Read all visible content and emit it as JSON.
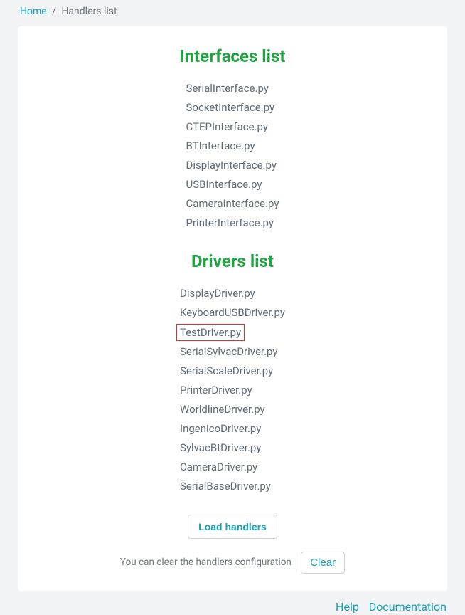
{
  "breadcrumb": {
    "home": "Home",
    "current": "Handlers list"
  },
  "sections": {
    "interfaces_title": "Interfaces list",
    "drivers_title": "Drivers list"
  },
  "interfaces": [
    "SerialInterface.py",
    "SocketInterface.py",
    "CTEPInterface.py",
    "BTInterface.py",
    "DisplayInterface.py",
    "USBInterface.py",
    "CameraInterface.py",
    "PrinterInterface.py"
  ],
  "drivers": [
    {
      "name": "DisplayDriver.py",
      "highlight": false
    },
    {
      "name": "KeyboardUSBDriver.py",
      "highlight": false
    },
    {
      "name": "TestDriver.py",
      "highlight": true
    },
    {
      "name": "SerialSylvacDriver.py",
      "highlight": false
    },
    {
      "name": "SerialScaleDriver.py",
      "highlight": false
    },
    {
      "name": "PrinterDriver.py",
      "highlight": false
    },
    {
      "name": "WorldlineDriver.py",
      "highlight": false
    },
    {
      "name": "IngenicoDriver.py",
      "highlight": false
    },
    {
      "name": "SylvacBtDriver.py",
      "highlight": false
    },
    {
      "name": "CameraDriver.py",
      "highlight": false
    },
    {
      "name": "SerialBaseDriver.py",
      "highlight": false
    }
  ],
  "actions": {
    "load_handlers": "Load handlers",
    "clear_prefix": "You can clear the handlers configuration",
    "clear_button": "Clear"
  },
  "footer": {
    "help": "Help",
    "documentation": "Documentation"
  }
}
